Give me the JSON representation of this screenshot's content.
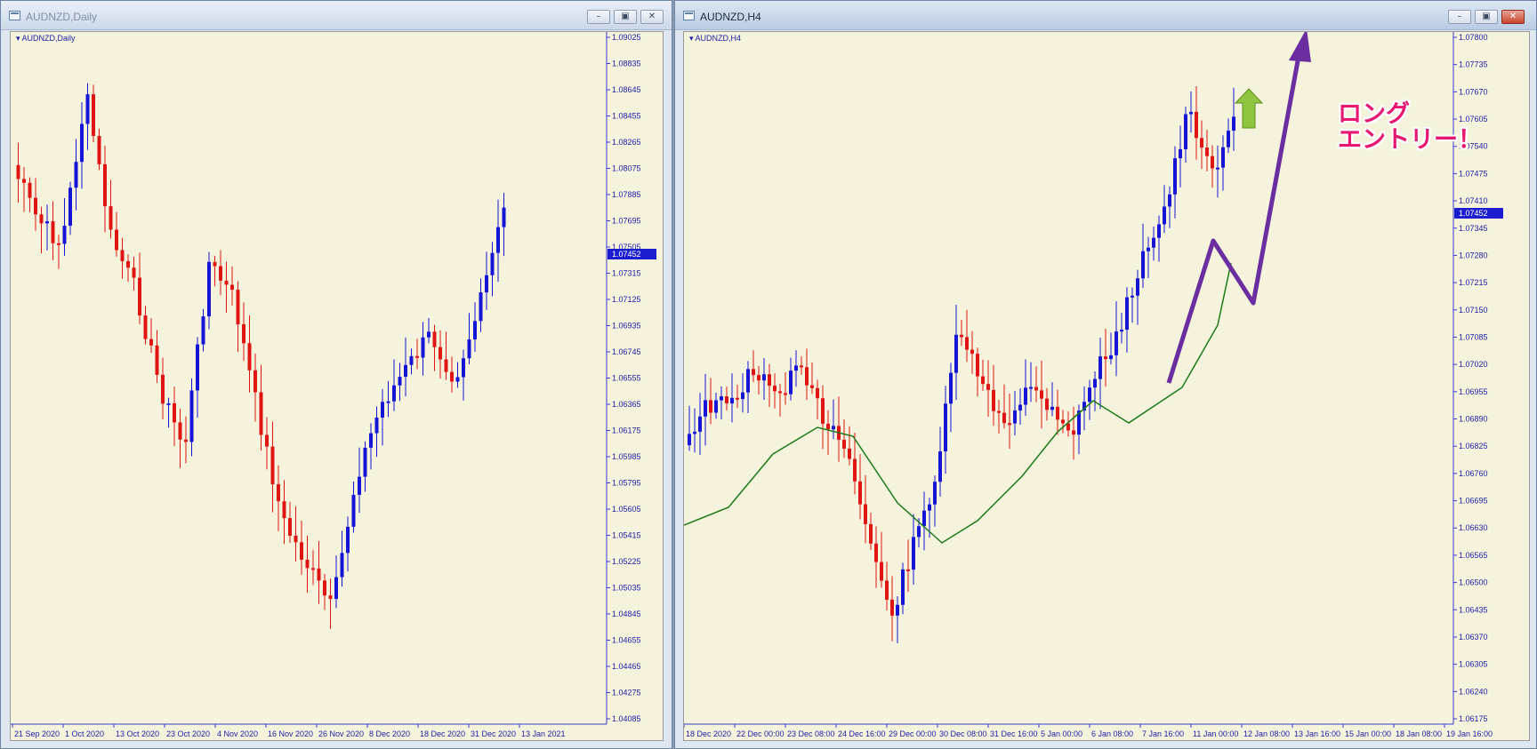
{
  "left": {
    "window_title": "AUDNZD,Daily",
    "chart_label": "AUDNZD,Daily",
    "price_tag": "1.07452",
    "y_ticks": [
      "1.09025",
      "1.08835",
      "1.08645",
      "1.08455",
      "1.08265",
      "1.08075",
      "1.07885",
      "1.07695",
      "1.07505",
      "1.07315",
      "1.07125",
      "1.06935",
      "1.06745",
      "1.06555",
      "1.06365",
      "1.06175",
      "1.05985",
      "1.05795",
      "1.05605",
      "1.05415",
      "1.05225",
      "1.05035",
      "1.04845",
      "1.04655",
      "1.04465",
      "1.04275",
      "1.04085"
    ],
    "x_ticks": [
      "21 Sep 2020",
      "1 Oct 2020",
      "13 Oct 2020",
      "23 Oct 2020",
      "4 Nov 2020",
      "16 Nov 2020",
      "26 Nov 2020",
      "8 Dec 2020",
      "18 Dec 2020",
      "31 Dec 2020",
      "13 Jan 2021"
    ]
  },
  "right": {
    "window_title": "AUDNZD,H4",
    "chart_label": "AUDNZD,H4",
    "price_tag": "1.07452",
    "y_ticks": [
      "1.07800",
      "1.07735",
      "1.07670",
      "1.07605",
      "1.07540",
      "1.07475",
      "1.07410",
      "1.07345",
      "1.07280",
      "1.07215",
      "1.07150",
      "1.07085",
      "1.07020",
      "1.06955",
      "1.06890",
      "1.06825",
      "1.06760",
      "1.06695",
      "1.06630",
      "1.06565",
      "1.06500",
      "1.06435",
      "1.06370",
      "1.06305",
      "1.06240",
      "1.06175"
    ],
    "x_ticks": [
      "18 Dec 2020",
      "22 Dec 00:00",
      "23 Dec 08:00",
      "24 Dec 16:00",
      "29 Dec 00:00",
      "30 Dec 08:00",
      "31 Dec 16:00",
      "5 Jan 00:00",
      "6 Jan 08:00",
      "7 Jan 16:00",
      "11 Jan 00:00",
      "12 Jan 08:00",
      "13 Jan 16:00",
      "15 Jan 00:00",
      "18 Jan 08:00",
      "19 Jan 16:00"
    ],
    "annotation_line1": "ロング",
    "annotation_line2": "エントリー！"
  },
  "colors": {
    "bull": "#1515d8",
    "bear": "#e01414",
    "ma": "#1a7a1a",
    "arrow": "#6a2ea0",
    "up_arrow": "#8fc43e",
    "background": "#f5f3dc"
  },
  "icons": [
    "window-icon",
    "minimize-icon",
    "restore-icon",
    "close-icon",
    "up-arrow-icon"
  ]
}
